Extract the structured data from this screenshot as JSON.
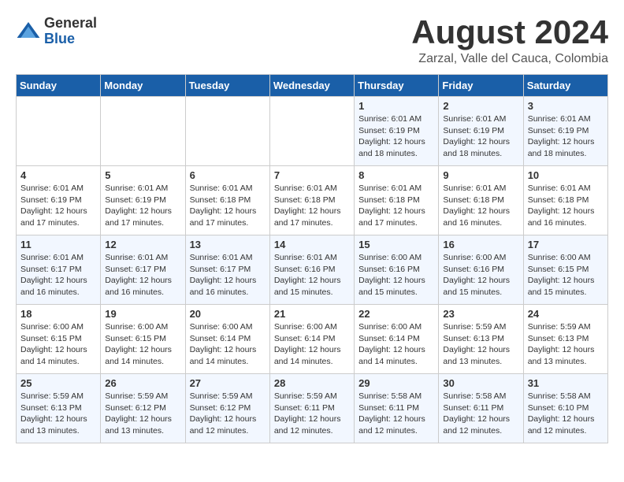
{
  "logo": {
    "general": "General",
    "blue": "Blue"
  },
  "title": "August 2024",
  "location": "Zarzal, Valle del Cauca, Colombia",
  "weekdays": [
    "Sunday",
    "Monday",
    "Tuesday",
    "Wednesday",
    "Thursday",
    "Friday",
    "Saturday"
  ],
  "weeks": [
    [
      {
        "day": "",
        "info": ""
      },
      {
        "day": "",
        "info": ""
      },
      {
        "day": "",
        "info": ""
      },
      {
        "day": "",
        "info": ""
      },
      {
        "day": "1",
        "info": "Sunrise: 6:01 AM\nSunset: 6:19 PM\nDaylight: 12 hours\nand 18 minutes."
      },
      {
        "day": "2",
        "info": "Sunrise: 6:01 AM\nSunset: 6:19 PM\nDaylight: 12 hours\nand 18 minutes."
      },
      {
        "day": "3",
        "info": "Sunrise: 6:01 AM\nSunset: 6:19 PM\nDaylight: 12 hours\nand 18 minutes."
      }
    ],
    [
      {
        "day": "4",
        "info": "Sunrise: 6:01 AM\nSunset: 6:19 PM\nDaylight: 12 hours\nand 17 minutes."
      },
      {
        "day": "5",
        "info": "Sunrise: 6:01 AM\nSunset: 6:19 PM\nDaylight: 12 hours\nand 17 minutes."
      },
      {
        "day": "6",
        "info": "Sunrise: 6:01 AM\nSunset: 6:18 PM\nDaylight: 12 hours\nand 17 minutes."
      },
      {
        "day": "7",
        "info": "Sunrise: 6:01 AM\nSunset: 6:18 PM\nDaylight: 12 hours\nand 17 minutes."
      },
      {
        "day": "8",
        "info": "Sunrise: 6:01 AM\nSunset: 6:18 PM\nDaylight: 12 hours\nand 17 minutes."
      },
      {
        "day": "9",
        "info": "Sunrise: 6:01 AM\nSunset: 6:18 PM\nDaylight: 12 hours\nand 16 minutes."
      },
      {
        "day": "10",
        "info": "Sunrise: 6:01 AM\nSunset: 6:18 PM\nDaylight: 12 hours\nand 16 minutes."
      }
    ],
    [
      {
        "day": "11",
        "info": "Sunrise: 6:01 AM\nSunset: 6:17 PM\nDaylight: 12 hours\nand 16 minutes."
      },
      {
        "day": "12",
        "info": "Sunrise: 6:01 AM\nSunset: 6:17 PM\nDaylight: 12 hours\nand 16 minutes."
      },
      {
        "day": "13",
        "info": "Sunrise: 6:01 AM\nSunset: 6:17 PM\nDaylight: 12 hours\nand 16 minutes."
      },
      {
        "day": "14",
        "info": "Sunrise: 6:01 AM\nSunset: 6:16 PM\nDaylight: 12 hours\nand 15 minutes."
      },
      {
        "day": "15",
        "info": "Sunrise: 6:00 AM\nSunset: 6:16 PM\nDaylight: 12 hours\nand 15 minutes."
      },
      {
        "day": "16",
        "info": "Sunrise: 6:00 AM\nSunset: 6:16 PM\nDaylight: 12 hours\nand 15 minutes."
      },
      {
        "day": "17",
        "info": "Sunrise: 6:00 AM\nSunset: 6:15 PM\nDaylight: 12 hours\nand 15 minutes."
      }
    ],
    [
      {
        "day": "18",
        "info": "Sunrise: 6:00 AM\nSunset: 6:15 PM\nDaylight: 12 hours\nand 14 minutes."
      },
      {
        "day": "19",
        "info": "Sunrise: 6:00 AM\nSunset: 6:15 PM\nDaylight: 12 hours\nand 14 minutes."
      },
      {
        "day": "20",
        "info": "Sunrise: 6:00 AM\nSunset: 6:14 PM\nDaylight: 12 hours\nand 14 minutes."
      },
      {
        "day": "21",
        "info": "Sunrise: 6:00 AM\nSunset: 6:14 PM\nDaylight: 12 hours\nand 14 minutes."
      },
      {
        "day": "22",
        "info": "Sunrise: 6:00 AM\nSunset: 6:14 PM\nDaylight: 12 hours\nand 14 minutes."
      },
      {
        "day": "23",
        "info": "Sunrise: 5:59 AM\nSunset: 6:13 PM\nDaylight: 12 hours\nand 13 minutes."
      },
      {
        "day": "24",
        "info": "Sunrise: 5:59 AM\nSunset: 6:13 PM\nDaylight: 12 hours\nand 13 minutes."
      }
    ],
    [
      {
        "day": "25",
        "info": "Sunrise: 5:59 AM\nSunset: 6:13 PM\nDaylight: 12 hours\nand 13 minutes."
      },
      {
        "day": "26",
        "info": "Sunrise: 5:59 AM\nSunset: 6:12 PM\nDaylight: 12 hours\nand 13 minutes."
      },
      {
        "day": "27",
        "info": "Sunrise: 5:59 AM\nSunset: 6:12 PM\nDaylight: 12 hours\nand 12 minutes."
      },
      {
        "day": "28",
        "info": "Sunrise: 5:59 AM\nSunset: 6:11 PM\nDaylight: 12 hours\nand 12 minutes."
      },
      {
        "day": "29",
        "info": "Sunrise: 5:58 AM\nSunset: 6:11 PM\nDaylight: 12 hours\nand 12 minutes."
      },
      {
        "day": "30",
        "info": "Sunrise: 5:58 AM\nSunset: 6:11 PM\nDaylight: 12 hours\nand 12 minutes."
      },
      {
        "day": "31",
        "info": "Sunrise: 5:58 AM\nSunset: 6:10 PM\nDaylight: 12 hours\nand 12 minutes."
      }
    ]
  ]
}
